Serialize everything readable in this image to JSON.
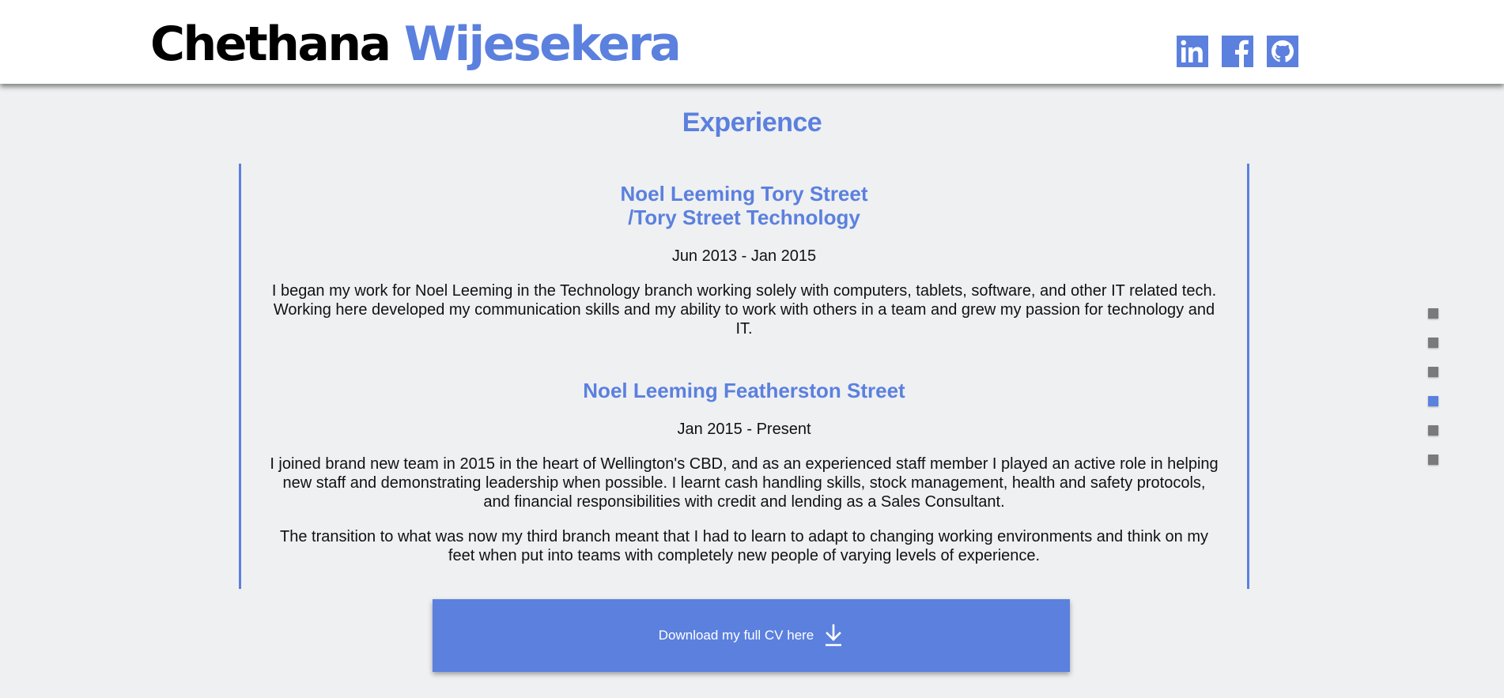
{
  "header": {
    "first_name": "Chethana",
    "last_name": "Wijesekera",
    "social": [
      {
        "name": "linkedin-icon"
      },
      {
        "name": "facebook-icon"
      },
      {
        "name": "github-icon"
      }
    ]
  },
  "section": {
    "title": "Experience"
  },
  "jobs": [
    {
      "title": "Noel Leeming Tory Street\n/Tory Street Technology",
      "date": "Jun 2013 - Jan 2015",
      "paragraphs": [
        "I began my work for Noel Leeming in the Technology branch working solely with computers, tablets, software, and other IT related tech. Working here developed my communication skills and my ability to work with others in a team and grew my passion for technology and IT."
      ]
    },
    {
      "title": "Noel Leeming Featherston Street",
      "date": "Jan 2015 - Present",
      "paragraphs": [
        "I joined brand new team in 2015 in the heart of Wellington's CBD, and as an experienced staff member I played an active role in helping new staff and demonstrating leadership when possible. I learnt cash handling skills, stock management, health and safety protocols, and financial responsibilities with credit and lending as a Sales Consultant.",
        "The transition to what was now my third branch meant that I had to learn to adapt to changing working environments and think on my feet when put into teams with completely new people of varying levels of experience."
      ]
    }
  ],
  "cv_button": {
    "label": "Download my full CV here",
    "icon": "download-icon"
  },
  "section_nav": {
    "count": 6,
    "active_index": 3
  },
  "colors": {
    "accent": "#5b80de",
    "background": "#eff0f2",
    "header_bg": "#ffffff",
    "dot_inactive": "#7a7a7a"
  }
}
